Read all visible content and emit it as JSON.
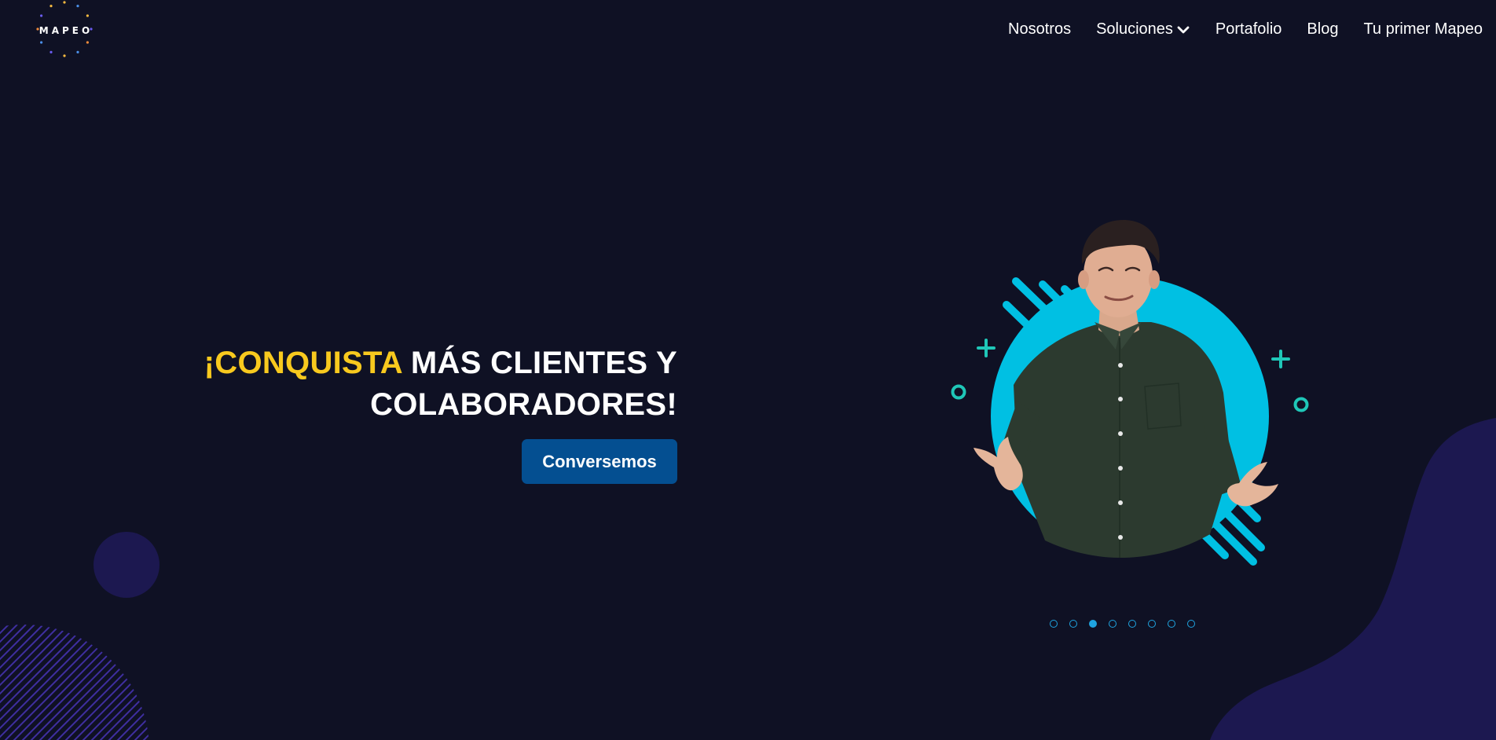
{
  "brand": {
    "logo_text": "MAPEO"
  },
  "nav": {
    "items": [
      {
        "label": "Nosotros"
      },
      {
        "label": "Soluciones",
        "has_dropdown": true
      },
      {
        "label": "Portafolio"
      },
      {
        "label": "Blog"
      },
      {
        "label": "Tu primer Mapeo"
      }
    ]
  },
  "hero": {
    "title_highlight": "¡CONQUISTA",
    "title_line1_rest": " MÁS CLIENTES Y",
    "title_line2": "COLABORADORES!",
    "cta_label": "Conversemos"
  },
  "carousel": {
    "slide_count": 8,
    "active_index": 2
  },
  "colors": {
    "background": "#0f1124",
    "highlight": "#f8c91e",
    "cta": "#044f91",
    "accent_cyan": "#00c0e3",
    "accent_teal": "#1fc7b8",
    "dot": "#1fa4e0",
    "shape_purple": "#1c1850"
  }
}
